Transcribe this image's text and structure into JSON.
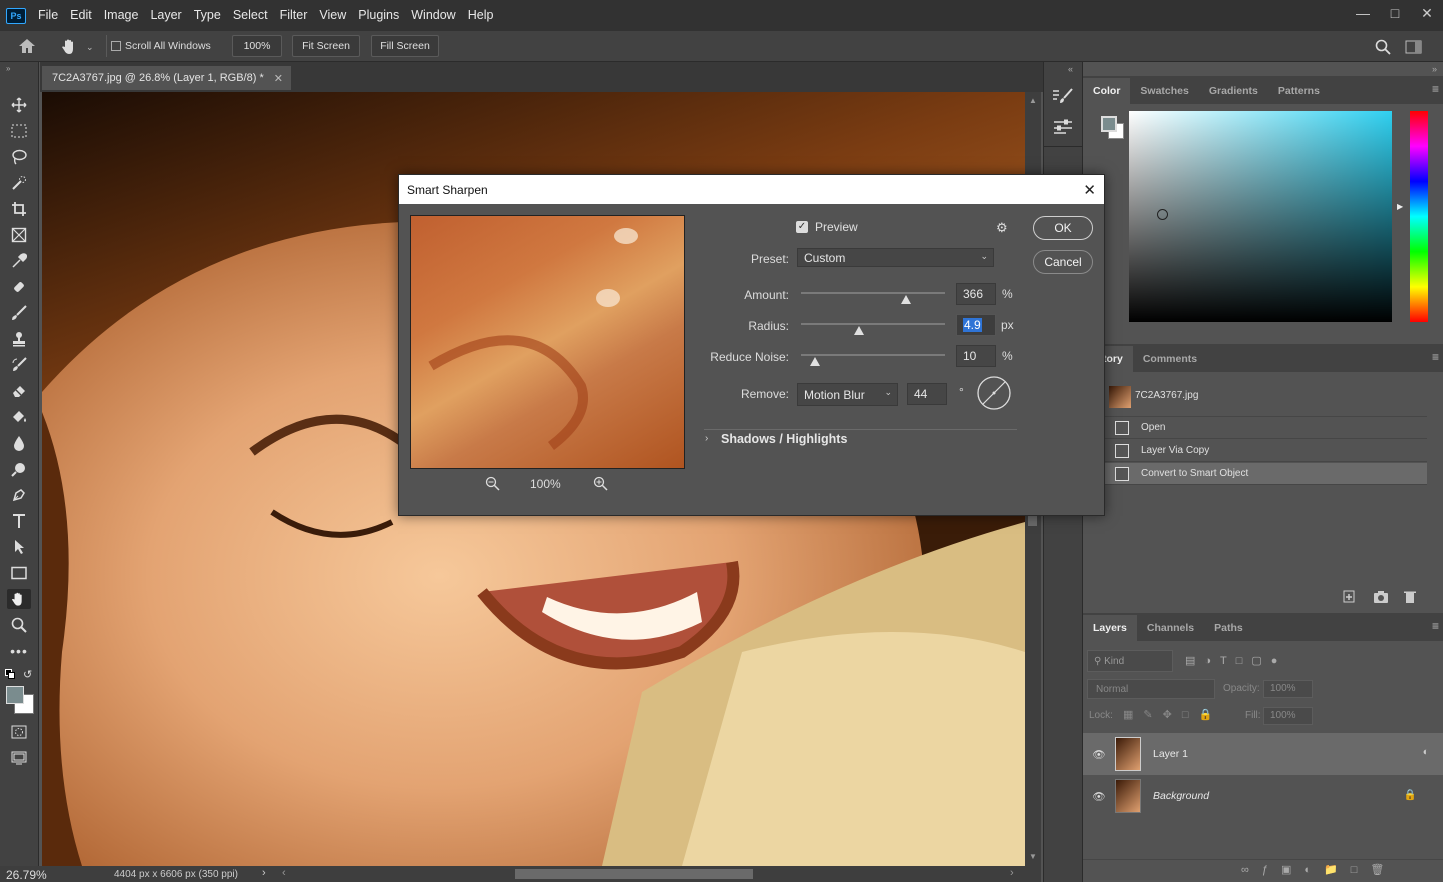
{
  "menubar": {
    "logo": "Ps",
    "items": [
      "File",
      "Edit",
      "Image",
      "Layer",
      "Type",
      "Select",
      "Filter",
      "View",
      "Plugins",
      "Window",
      "Help"
    ]
  },
  "options": {
    "scroll_all_windows": "Scroll All Windows",
    "zoom_btn": "100%",
    "fit_screen": "Fit Screen",
    "fill_screen": "Fill Screen"
  },
  "document": {
    "tab_title": "7C2A3767.jpg @ 26.8% (Layer 1, RGB/8) *",
    "zoom_readout": "26.79%",
    "doc_info": "4404 px x 6606 px (350 ppi)"
  },
  "color_panel": {
    "tabs": [
      "Color",
      "Swatches",
      "Gradients",
      "Patterns"
    ],
    "base_hue": "#2fd0f0"
  },
  "history_panel": {
    "tabs": [
      "tory",
      "Comments"
    ],
    "snapshot": "7C2A3767.jpg",
    "states": [
      "Open",
      "Layer Via Copy",
      "Convert to Smart Object"
    ]
  },
  "layers_panel": {
    "tabs": [
      "Layers",
      "Channels",
      "Paths"
    ],
    "kind": "Kind",
    "blend_mode": "Normal",
    "opacity_label": "Opacity:",
    "opacity_value": "100%",
    "lock_label": "Lock:",
    "fill_label": "Fill:",
    "fill_value": "100%",
    "layers": [
      {
        "name": "Layer 1"
      },
      {
        "name": "Background"
      }
    ]
  },
  "dialog": {
    "title": "Smart Sharpen",
    "preview_label": "Preview",
    "ok": "OK",
    "cancel": "Cancel",
    "preset_label": "Preset:",
    "preset_value": "Custom",
    "amount_label": "Amount:",
    "amount_value": "366",
    "amount_unit": "%",
    "amount_level": 0.73,
    "radius_label": "Radius:",
    "radius_value": "4.9",
    "radius_unit": "px",
    "noise_label": "Reduce Noise:",
    "noise_value": "10",
    "noise_unit": "%",
    "remove_label": "Remove:",
    "remove_value": "Motion Blur",
    "angle_value": "44",
    "angle_unit": "°",
    "shadows_highlights": "Shadows / Highlights",
    "preview_zoom": "100%"
  }
}
